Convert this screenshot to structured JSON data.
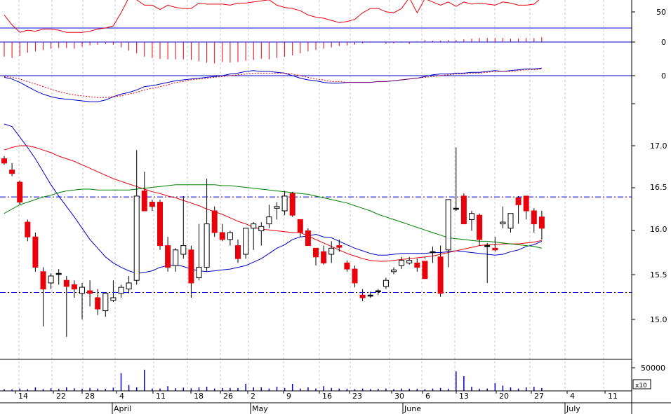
{
  "colors": {
    "up_fill": "#ffffff",
    "down_fill": "#e8000b",
    "doji": "#000000",
    "rsi": "#e8000b",
    "ma_short": "#0000cc",
    "ma_mid": "#e8000b",
    "ma_long": "#008000",
    "level_line": "#0000cc",
    "grid": "#c8c8c8"
  },
  "chart_data": [
    {
      "type": "line",
      "panel": "rsi",
      "y_ticks": [
        "50"
      ],
      "reference_level": 38,
      "values": [
        50,
        41,
        34,
        36,
        35,
        37,
        37,
        36,
        34,
        34,
        34,
        35,
        37,
        38,
        40,
        52,
        66,
        64,
        59,
        59,
        55,
        59,
        57,
        56,
        56,
        61,
        60,
        60,
        60,
        59,
        61,
        61,
        62,
        63,
        64,
        59,
        57,
        56,
        54,
        50,
        48,
        47,
        45,
        43,
        44,
        46,
        52,
        56,
        56,
        53,
        52,
        56,
        66,
        52,
        65,
        62,
        59,
        62,
        58,
        62,
        60,
        61,
        60,
        59,
        62,
        61,
        59,
        59,
        60,
        66
      ]
    },
    {
      "type": "bar",
      "panel": "macd-histogram",
      "y_ticks": [
        "0"
      ],
      "values": [
        -2.2,
        -2.4,
        -2.1,
        -1.6,
        -1.4,
        -1.2,
        -1.0,
        -0.9,
        -0.9,
        -1.0,
        -0.7,
        -0.5,
        -0.4,
        -0.3,
        -0.4,
        -0.8,
        -1.3,
        -1.7,
        -2.2,
        -2.4,
        -2.5,
        -2.6,
        -2.6,
        -2.6,
        -2.7,
        -2.9,
        -3.1,
        -3.2,
        -3.0,
        -3.1,
        -3.0,
        -2.8,
        -2.7,
        -2.5,
        -2.6,
        -2.4,
        -2.2,
        -2.0,
        -1.7,
        -1.4,
        -1.2,
        -1.0,
        -0.8,
        -0.6,
        -0.5,
        -0.4,
        -0.2,
        -0.1,
        0.0,
        -0.3,
        -0.2,
        -0.1,
        -0.3,
        0.1,
        0.3,
        0.2,
        0.2,
        0.3,
        0.3,
        0.4,
        0.5,
        0.6,
        0.6,
        0.6,
        0.6,
        0.5,
        0.5,
        0.6,
        0.6,
        0.7
      ]
    },
    {
      "type": "line",
      "panel": "macd",
      "y_ticks": [
        "0"
      ],
      "series": [
        {
          "values": [
            -0.02,
            -0.04,
            -0.08,
            -0.13,
            -0.18,
            -0.22,
            -0.25,
            -0.27,
            -0.28,
            -0.29,
            -0.3,
            -0.31,
            -0.31,
            -0.29,
            -0.25,
            -0.22,
            -0.2,
            -0.17,
            -0.13,
            -0.12,
            -0.1,
            -0.08,
            -0.06,
            -0.05,
            -0.04,
            -0.03,
            -0.02,
            -0.01,
            0.0,
            0.02,
            0.03,
            0.05,
            0.06,
            0.05,
            0.05,
            0.04,
            0.03,
            0.0,
            -0.03,
            -0.05,
            -0.06,
            -0.08,
            -0.09,
            -0.09,
            -0.08,
            -0.08,
            -0.08,
            -0.08,
            -0.07,
            -0.07,
            -0.06,
            -0.05,
            -0.04,
            -0.03,
            -0.01,
            0.01,
            0.02,
            0.02,
            0.03,
            0.03,
            0.04,
            0.04,
            0.05,
            0.06,
            0.05,
            0.06,
            0.07,
            0.08,
            0.08,
            0.09
          ]
        },
        {
          "values": [
            -0.01,
            -0.02,
            -0.04,
            -0.07,
            -0.1,
            -0.13,
            -0.16,
            -0.19,
            -0.21,
            -0.23,
            -0.24,
            -0.25,
            -0.26,
            -0.26,
            -0.25,
            -0.24,
            -0.22,
            -0.2,
            -0.17,
            -0.15,
            -0.13,
            -0.11,
            -0.08,
            -0.07,
            -0.05,
            -0.04,
            -0.03,
            -0.02,
            -0.01,
            0.0,
            0.01,
            0.02,
            0.03,
            0.03,
            0.03,
            0.03,
            0.03,
            0.02,
            0.0,
            -0.02,
            -0.04,
            -0.05,
            -0.07,
            -0.07,
            -0.08,
            -0.08,
            -0.08,
            -0.08,
            -0.07,
            -0.07,
            -0.06,
            -0.05,
            -0.04,
            -0.03,
            -0.02,
            -0.01,
            0.0,
            0.01,
            0.02,
            0.02,
            0.03,
            0.03,
            0.04,
            0.05,
            0.05,
            0.05,
            0.06,
            0.07,
            0.07,
            0.08
          ]
        }
      ]
    },
    {
      "type": "candlestick",
      "panel": "price",
      "y_ticks": [
        "17.0",
        "16.5",
        "16.0",
        "15.5",
        "15.0"
      ],
      "ylim": [
        14.78,
        17.3
      ],
      "x_ticks": [
        "14",
        "22",
        "28",
        "4",
        "11",
        "18",
        "26",
        "2",
        "9",
        "16",
        "23",
        "30",
        "6",
        "13",
        "20",
        "27",
        "4",
        "11"
      ],
      "month_labels": [
        "April",
        "May",
        "June",
        "July"
      ],
      "reference_levels": [
        16.41,
        15.31
      ],
      "candles": [
        [
          16.85,
          16.88,
          16.78,
          16.8
        ],
        [
          16.72,
          16.8,
          16.65,
          16.68
        ],
        [
          16.58,
          16.6,
          16.32,
          16.35
        ],
        [
          16.12,
          16.15,
          15.9,
          15.95
        ],
        [
          15.95,
          16.0,
          15.55,
          15.6
        ],
        [
          15.55,
          15.6,
          14.92,
          15.35
        ],
        [
          15.42,
          15.53,
          15.35,
          15.5
        ],
        [
          15.53,
          15.58,
          15.4,
          15.52
        ],
        [
          15.45,
          15.5,
          14.8,
          15.38
        ],
        [
          15.4,
          15.45,
          15.25,
          15.35
        ],
        [
          15.3,
          15.42,
          15.0,
          15.37
        ],
        [
          15.33,
          15.45,
          15.15,
          15.3
        ],
        [
          15.25,
          15.35,
          15.05,
          15.12
        ],
        [
          15.1,
          15.28,
          15.03,
          15.3
        ],
        [
          15.22,
          15.45,
          15.2,
          15.25
        ],
        [
          15.3,
          15.4,
          15.25,
          15.37
        ],
        [
          15.35,
          15.5,
          15.3,
          15.42
        ],
        [
          15.45,
          16.95,
          15.4,
          16.42
        ],
        [
          16.48,
          16.7,
          16.25,
          16.25
        ],
        [
          16.35,
          16.38,
          16.25,
          16.3
        ],
        [
          16.35,
          16.38,
          15.8,
          15.85
        ],
        [
          15.85,
          15.95,
          15.55,
          15.6
        ],
        [
          15.62,
          15.82,
          15.55,
          15.8
        ],
        [
          15.75,
          16.42,
          15.7,
          15.85
        ],
        [
          15.8,
          15.85,
          15.25,
          15.42
        ],
        [
          15.48,
          16.1,
          15.45,
          15.6
        ],
        [
          15.6,
          16.62,
          15.55,
          16.1
        ],
        [
          16.25,
          16.3,
          15.95,
          16.0
        ],
        [
          16.0,
          16.1,
          15.9,
          15.92
        ],
        [
          15.92,
          16.02,
          15.85,
          16.0
        ],
        [
          15.85,
          15.92,
          15.65,
          15.7
        ],
        [
          15.75,
          16.02,
          15.7,
          16.05
        ],
        [
          16.05,
          16.12,
          15.8,
          16.1
        ],
        [
          16.02,
          16.12,
          15.85,
          16.07
        ],
        [
          16.1,
          16.32,
          16.05,
          16.18
        ],
        [
          16.28,
          16.35,
          16.15,
          16.3
        ],
        [
          16.25,
          16.48,
          16.2,
          16.42
        ],
        [
          16.45,
          16.47,
          16.18,
          16.2
        ],
        [
          16.15,
          16.15,
          15.95,
          16.0
        ],
        [
          16.02,
          16.05,
          15.85,
          15.85
        ],
        [
          15.82,
          15.82,
          15.62,
          15.72
        ],
        [
          15.78,
          15.85,
          15.63,
          15.65
        ],
        [
          15.75,
          15.9,
          15.65,
          15.82
        ],
        [
          15.85,
          15.92,
          15.78,
          15.83
        ],
        [
          15.65,
          15.68,
          15.55,
          15.58
        ],
        [
          15.58,
          15.62,
          15.37,
          15.42
        ],
        [
          15.28,
          15.35,
          15.21,
          15.25
        ],
        [
          15.28,
          15.32,
          15.25,
          15.28
        ],
        [
          15.32,
          15.35,
          15.28,
          15.33
        ],
        [
          15.38,
          15.48,
          15.35,
          15.45
        ],
        [
          15.55,
          15.6,
          15.52,
          15.57
        ],
        [
          15.62,
          15.72,
          15.58,
          15.68
        ],
        [
          15.65,
          15.72,
          15.63,
          15.68
        ],
        [
          15.65,
          15.7,
          15.55,
          15.6
        ],
        [
          15.67,
          15.72,
          15.7,
          15.47
        ],
        [
          15.78,
          15.84,
          15.65,
          15.78
        ],
        [
          15.72,
          15.85,
          15.26,
          15.3
        ],
        [
          15.8,
          16.38,
          15.6,
          16.38
        ],
        [
          16.28,
          16.98,
          16.25,
          16.28
        ],
        [
          16.42,
          16.45,
          16.1,
          16.1
        ],
        [
          16.15,
          16.25,
          16.02,
          16.22
        ],
        [
          16.2,
          16.22,
          15.85,
          15.92
        ],
        [
          15.85,
          15.88,
          15.42,
          15.85
        ],
        [
          15.82,
          15.95,
          15.78,
          15.8
        ],
        [
          16.1,
          16.3,
          16.05,
          16.12
        ],
        [
          16.05,
          16.12,
          16.0,
          16.22
        ],
        [
          16.4,
          16.42,
          16.1,
          16.32
        ],
        [
          16.42,
          16.42,
          16.15,
          16.25
        ],
        [
          16.25,
          16.28,
          16.0,
          16.1
        ],
        [
          16.18,
          16.25,
          15.92,
          16.05
        ]
      ],
      "series": [
        {
          "values": [
            17.25,
            17.22,
            17.1,
            16.98,
            16.85,
            16.7,
            16.55,
            16.42,
            16.3,
            16.18,
            16.05,
            15.92,
            15.82,
            15.72,
            15.65,
            15.6,
            15.56,
            15.53,
            15.54,
            15.56,
            15.6,
            15.62,
            15.63,
            15.61,
            15.58,
            15.56,
            15.55,
            15.56,
            15.57,
            15.58,
            15.6,
            15.62,
            15.66,
            15.7,
            15.76,
            15.82,
            15.86,
            15.92,
            15.95,
            15.96,
            15.98,
            15.95,
            15.94,
            15.9,
            15.86,
            15.82,
            15.79,
            15.76,
            15.74,
            15.74,
            15.75,
            15.76,
            15.76,
            15.76,
            15.76,
            15.77,
            15.77,
            15.78,
            15.79,
            15.78,
            15.77,
            15.76,
            15.75,
            15.74,
            15.75,
            15.78,
            15.8,
            15.84,
            15.86,
            15.9
          ]
        },
        {
          "values": [
            16.95,
            16.98,
            17.0,
            17.0,
            16.98,
            16.95,
            16.92,
            16.88,
            16.85,
            16.82,
            16.78,
            16.74,
            16.7,
            16.66,
            16.62,
            16.59,
            16.56,
            16.53,
            16.5,
            16.47,
            16.45,
            16.42,
            16.4,
            16.37,
            16.34,
            16.31,
            16.27,
            16.24,
            16.21,
            16.17,
            16.13,
            16.1,
            16.06,
            16.04,
            16.03,
            16.02,
            16.01,
            16.0,
            16.0,
            15.96,
            15.92,
            15.88,
            15.84,
            15.8,
            15.76,
            15.73,
            15.7,
            15.68,
            15.67,
            15.67,
            15.68,
            15.69,
            15.7,
            15.71,
            15.72,
            15.73,
            15.75,
            15.77,
            15.79,
            15.81,
            15.83,
            15.85,
            15.86,
            15.86,
            15.87,
            15.87,
            15.87,
            15.88,
            15.89,
            15.91
          ]
        },
        {
          "values": [
            16.22,
            16.27,
            16.32,
            16.35,
            16.38,
            16.41,
            16.43,
            16.46,
            16.48,
            16.49,
            16.5,
            16.5,
            16.49,
            16.49,
            16.49,
            16.49,
            16.49,
            16.5,
            16.51,
            16.52,
            16.53,
            16.54,
            16.55,
            16.55,
            16.55,
            16.55,
            16.55,
            16.55,
            16.54,
            16.54,
            16.53,
            16.52,
            16.51,
            16.5,
            16.49,
            16.48,
            16.47,
            16.46,
            16.45,
            16.44,
            16.42,
            16.4,
            16.38,
            16.36,
            16.34,
            16.31,
            16.28,
            16.25,
            16.21,
            16.18,
            16.15,
            16.12,
            16.09,
            16.06,
            16.03,
            16.0,
            15.97,
            15.94,
            15.93,
            15.92,
            15.91,
            15.9,
            15.9,
            15.89,
            15.88,
            15.87,
            15.86,
            15.85,
            15.84,
            15.82
          ]
        }
      ]
    },
    {
      "type": "bar",
      "panel": "volume",
      "y_ticks": [
        "50000"
      ],
      "multiplier_label": "x10",
      "values": [
        3000,
        2500,
        4000,
        3000,
        6000,
        3000,
        4500,
        3500,
        6000,
        4500,
        3500,
        5000,
        4000,
        3500,
        5500,
        30000,
        10000,
        6000,
        36000,
        4000,
        4000,
        8000,
        4500,
        5500,
        4500,
        6000,
        7000,
        4000,
        5000,
        5000,
        5000,
        12000,
        6000,
        6000,
        4000,
        7000,
        5000,
        12000,
        4000,
        6000,
        4000,
        8000,
        5000,
        4000,
        3500,
        3000,
        4000,
        3000,
        3500,
        4000,
        3000,
        4000,
        3500,
        3500,
        3000,
        4000,
        5000,
        3500,
        33000,
        25000,
        7000,
        3500,
        4000,
        13000,
        9000,
        6000,
        4000,
        6000,
        7000,
        5000
      ]
    }
  ]
}
